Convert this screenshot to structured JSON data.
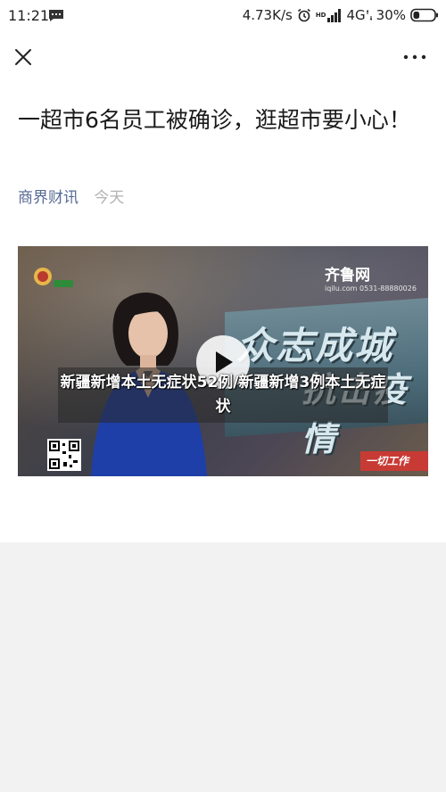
{
  "status_bar": {
    "time": "11:21",
    "speed": "4.73K/s",
    "hd_label": "HD",
    "network": "4G",
    "battery": "30%",
    "battery_level": 0.3
  },
  "article": {
    "title": "一超市6名员工被确诊，逛超市要小心！",
    "source": "商界财讯",
    "date": "今天"
  },
  "video": {
    "caption": "新疆新增本土无症状52例/新疆新增3例本土无症状",
    "bg_text_top": "众志成城",
    "bg_text_bottom": "抗击疫情",
    "channel_logo": "齐鲁网",
    "channel_sub": "iqilu.com  0531-88880026",
    "ticker": "一切工作"
  }
}
